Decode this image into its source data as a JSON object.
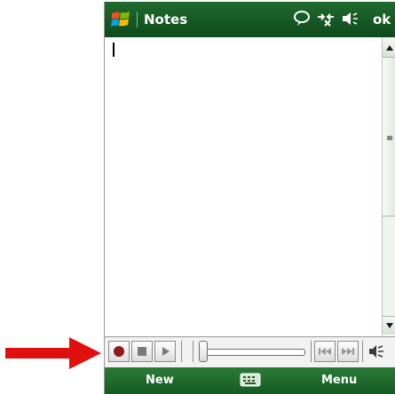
{
  "app": {
    "title": "Notes",
    "ok_label": "ok"
  },
  "status_icons": [
    "chat-bubble-icon",
    "connectivity-icon",
    "speaker-icon"
  ],
  "note": {
    "content": ""
  },
  "recorder": {
    "buttons": [
      "record-icon",
      "stop-icon",
      "play-icon",
      "previous-icon",
      "next-icon",
      "volume-icon"
    ],
    "position": 0
  },
  "softkeys": {
    "left": "New",
    "right": "Menu",
    "center_icon": "keyboard-icon"
  },
  "colors": {
    "titlebar": "#1f6a2e",
    "softkeys": "#2b7a38",
    "record_dot": "#8b1a1a",
    "arrow": "#e0100f"
  }
}
